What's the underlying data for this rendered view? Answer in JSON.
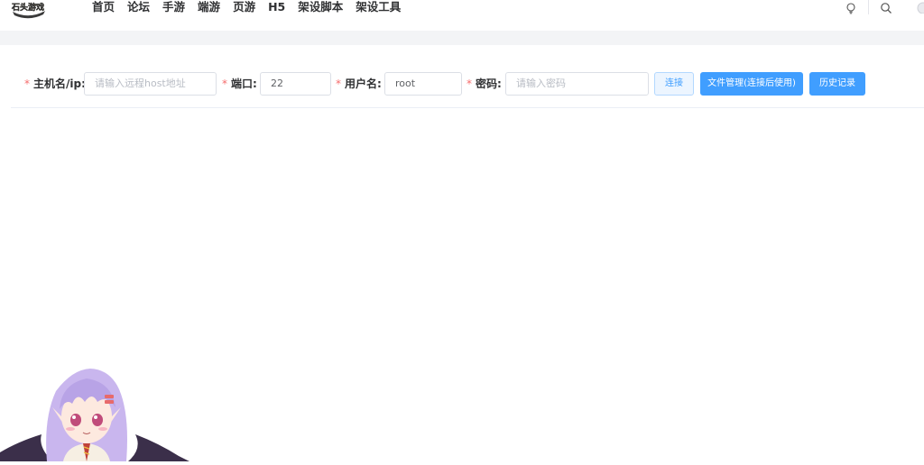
{
  "nav": {
    "items": [
      "首页",
      "论坛",
      "手游",
      "端游",
      "页游",
      "H5",
      "架设脚本",
      "架设工具"
    ]
  },
  "logo": {
    "text": "石头游戏"
  },
  "icons": {
    "right": [
      "bulb-icon",
      "search-icon",
      "avatar"
    ]
  },
  "form": {
    "host": {
      "label": "主机名/ip:",
      "required_mark": "*",
      "value": "",
      "placeholder": "请输入远程host地址"
    },
    "port": {
      "label": "端口:",
      "required_mark": "*",
      "value": "22"
    },
    "user": {
      "label": "用户名:",
      "required_mark": "*",
      "value": "root"
    },
    "password": {
      "label": "密码:",
      "required_mark": "*",
      "value": "",
      "placeholder": "请输入密码"
    },
    "connect_label": "连接",
    "file_manager_label": "文件管理(连接后使用)",
    "history_label": "历史记录"
  },
  "colors": {
    "primary": "#409eff",
    "required": "#f56c6c",
    "band": "#f3f4f6",
    "mascot_hair": "#c9b6ee"
  }
}
